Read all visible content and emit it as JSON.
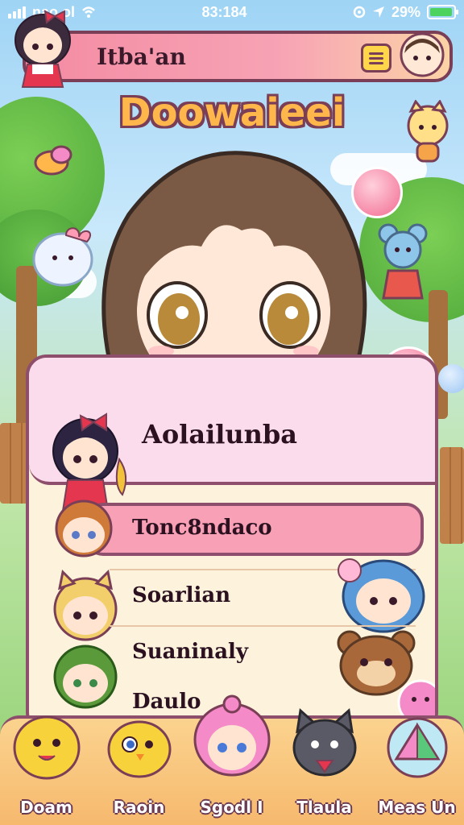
{
  "status_bar": {
    "left_text": "nao ol",
    "time": "83:184",
    "battery": "29%",
    "battery_level": 0.95
  },
  "header": {
    "title": "Itba'an"
  },
  "app_logo": "Doowaieei",
  "list": {
    "featured": {
      "label": "Aolailunba"
    },
    "items": [
      {
        "label": "Tonc8ndaco",
        "selected": true
      },
      {
        "label": "Soarlian",
        "selected": false
      },
      {
        "label": "Suaninaly",
        "selected": false
      },
      {
        "label": "Daulo",
        "selected": false
      }
    ]
  },
  "bottom_nav": {
    "items": [
      {
        "label": "Doam",
        "icon": "yellow-creature-icon"
      },
      {
        "label": "Raoin",
        "icon": "yellow-chick-icon"
      },
      {
        "label": "Sgodl I",
        "icon": "pink-hair-girl-icon"
      },
      {
        "label": "Tlaula",
        "icon": "gray-cat-icon"
      },
      {
        "label": "Meas Un",
        "icon": "pyramid-orb-icon"
      }
    ]
  },
  "colors": {
    "accent_pink": "#f7a0b6",
    "border_plum": "#8e4f6c",
    "panel_cream": "#fdf3dc",
    "logo_orange": "#ffb64a"
  }
}
